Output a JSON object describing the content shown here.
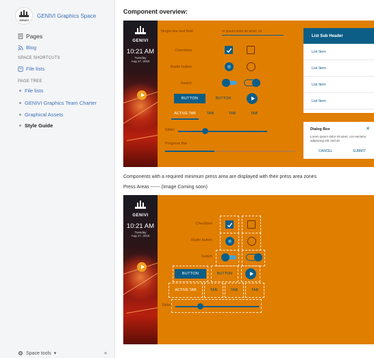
{
  "sidebar": {
    "space_title": "GENIVI Graphics Space",
    "logo_text": "GENIVI",
    "pages_label": "Pages",
    "blog_label": "Blog",
    "shortcuts_heading": "SPACE SHORTCUTS",
    "shortcut_file_lists": "File lists",
    "tree_heading": "PAGE TREE",
    "tree": [
      {
        "label": "File lists",
        "current": false
      },
      {
        "label": "GENIVI Graphics Team Charter",
        "current": false
      },
      {
        "label": "Graphical Assets",
        "current": false
      },
      {
        "label": "Style Guide",
        "current": true
      }
    ],
    "space_tools": "Space tools",
    "collapse_icon": "double-chevron-left-icon"
  },
  "main": {
    "heading": "Component overview:",
    "press_desc": "Components with a required minimum press area are displayed with their press area zones",
    "press_caption": "Press Areas ------ (Image Coming soon)"
  },
  "mock": {
    "brand": "GENIVI",
    "time": "10:21 AM",
    "day": "Tuesday",
    "date": "Aug 17, 2016",
    "single_line_label": "Single-line text field",
    "single_line_value": "m ipsum dolor sit amet, co",
    "checkbox_label": "Checkbox",
    "radio_label": "Radio button",
    "switch_label": "Switch",
    "button_filled": "BUTTON",
    "button_text": "BUTTON",
    "tabs": [
      "ACTIVE TAB",
      "TAB",
      "TAB",
      "TAB"
    ],
    "slider_label": "Slider",
    "slider_value": 0.3,
    "progress_label": "Progress Bar",
    "progress_value": 0.38,
    "list_header": "List Sub Header",
    "list_items": [
      "List Item",
      "List Item",
      "List Item",
      "List Item"
    ],
    "dialog_title": "Dialog Box",
    "dialog_body": "Lorem ipsum dolor sit amet, con-sectetur adipiscing elit, sed do",
    "dialog_cancel": "CANCEL",
    "dialog_submit": "SUBMIT",
    "colors": {
      "panel": "#e07e00",
      "component": "#0d5e87",
      "accent": "#4aa3cf",
      "link": "#3a70b8"
    }
  }
}
